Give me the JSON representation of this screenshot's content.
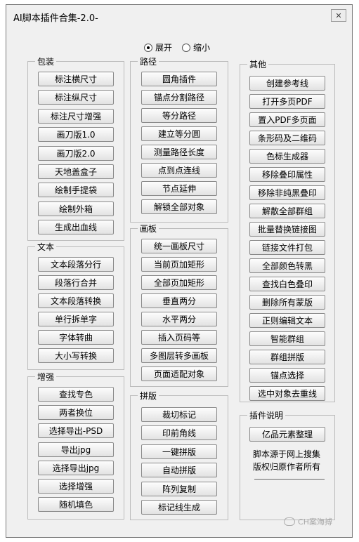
{
  "window": {
    "title": "AI脚本插件合集-2.0-",
    "close_symbol": "✕"
  },
  "view_mode": {
    "options": [
      {
        "label": "展开",
        "selected": true
      },
      {
        "label": "缩小",
        "selected": false
      }
    ]
  },
  "groups": {
    "packaging": {
      "label": "包装",
      "buttons": [
        "标注横尺寸",
        "标注纵尺寸",
        "标注尺寸增强",
        "画刀版1.0",
        "画刀版2.0",
        "天地盖盒子",
        "绘制手提袋",
        "绘制外箱",
        "生成出血线"
      ]
    },
    "text": {
      "label": "文本",
      "buttons": [
        "文本段落分行",
        "段落行合并",
        "文本段落转换",
        "单行拆单字",
        "字体转曲",
        "大小写转换"
      ]
    },
    "enhance": {
      "label": "增强",
      "buttons": [
        "查找专色",
        "两者换位",
        "选择导出-PSD",
        "导出jpg",
        "选择导出jpg",
        "选择增强",
        "随机填色"
      ]
    },
    "path": {
      "label": "路径",
      "buttons": [
        "圆角插件",
        "锚点分割路径",
        "等分路径",
        "建立等分圆",
        "测量路径长度",
        "点到点连线",
        "节点延伸",
        "解锁全部对象"
      ]
    },
    "artboard": {
      "label": "画板",
      "buttons": [
        "统一画板尺寸",
        "当前页加矩形",
        "全部页加矩形",
        "垂直两分",
        "水平两分",
        "插入页码等",
        "多图层转多画板",
        "页面适配对象"
      ]
    },
    "imposition": {
      "label": "拼版",
      "buttons": [
        "裁切标记",
        "印前角线",
        "一键拼版",
        "自动拼版",
        "阵列复制",
        "标记线生成"
      ]
    },
    "other": {
      "label": "其他",
      "buttons": [
        "创建参考线",
        "打开多页PDF",
        "置入PDF多页面",
        "条形码及二维码",
        "色标生成器",
        "移除叠印属性",
        "移除非纯黑叠印",
        "解散全部群组",
        "批量替换链接图",
        "链接文件打包",
        "全部颜色转黑",
        "查找白色叠印",
        "删除所有蒙版",
        "正则编辑文本",
        "智能群组",
        "群组拼版",
        "锚点选择",
        "选中对象去重线"
      ]
    },
    "plugin_info": {
      "label": "插件说明",
      "buttons": [
        "亿品元素整理"
      ],
      "lines": [
        "脚本源于网上搜集",
        "版权归原作者所有"
      ]
    }
  },
  "watermark": {
    "text": "CH案海搏"
  }
}
